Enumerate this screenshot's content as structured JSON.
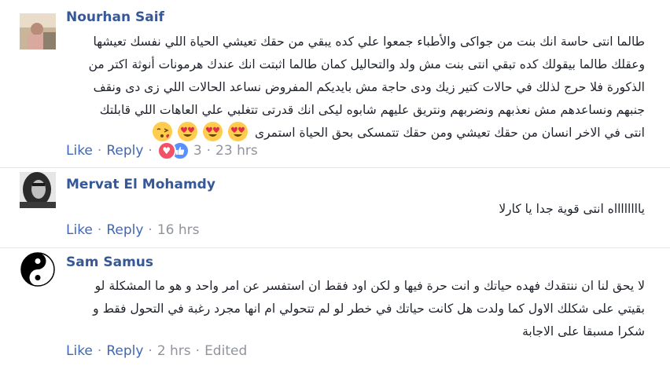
{
  "comments": [
    {
      "author": "Nourhan Saif",
      "lines": [
        "طالما انتى حاسة انك بنت من جواكى والأطباء جمعوا علي كده يبقي من حقك تعيشي الحياة اللي نفسك تعيشها",
        "وعقلك طالما بيقولك كده تبقي انتى بنت مش ولد والتحاليل كمان طالما اثبتت انك عندك هرمونات أنوثة اكتر من",
        "الذكورة فلا حرج لذلك في حالات كتير زيك ودى حاجة مش بايديكم المفروض نساعد الحالات اللي زى دى ونقف",
        "جنبهم ونساعدهم مش نعذبهم ونضربهم ونتريق عليهم شابوه ليكى انك قدرتى تتغلبي علي العاهات اللي قابلتك",
        "انتى في الاخر انسان من حقك تعيشي ومن حقك تتمسكى بحق الحياة استمرى"
      ],
      "like_label": "Like",
      "reply_label": "Reply",
      "reaction_count": "3",
      "time": "23 hrs",
      "emoji_icons": [
        "heart-eyes-icon",
        "heart-eyes-icon",
        "heart-eyes-icon",
        "kissing-heart-icon"
      ]
    },
    {
      "author": "Mervat El Mohamdy",
      "lines": [
        "يااااااااه انتى قوية جدا يا كارلا"
      ],
      "like_label": "Like",
      "reply_label": "Reply",
      "time": "16 hrs"
    },
    {
      "author": "Sam Samus",
      "lines": [
        "لا يحق لنا ان ننتقدك فهده حياتك و انت حرة فيها و لكن اود فقط ان استفسر عن امر واحد و هو ما المشكلة لو",
        "بقيتي على شكلك الاول كما ولدت هل كانت حياتك في خطر لو لم تتحولي ام انها مجرد رغبة في التحول فقط و",
        "شكرا مسبقا على الاجابة"
      ],
      "like_label": "Like",
      "reply_label": "Reply",
      "time": "2 hrs",
      "edited_label": "Edited"
    }
  ],
  "colors": {
    "link": "#4267b2",
    "name": "#365899",
    "meta": "#90949c",
    "love": "#f25268",
    "like": "#5890ff"
  }
}
